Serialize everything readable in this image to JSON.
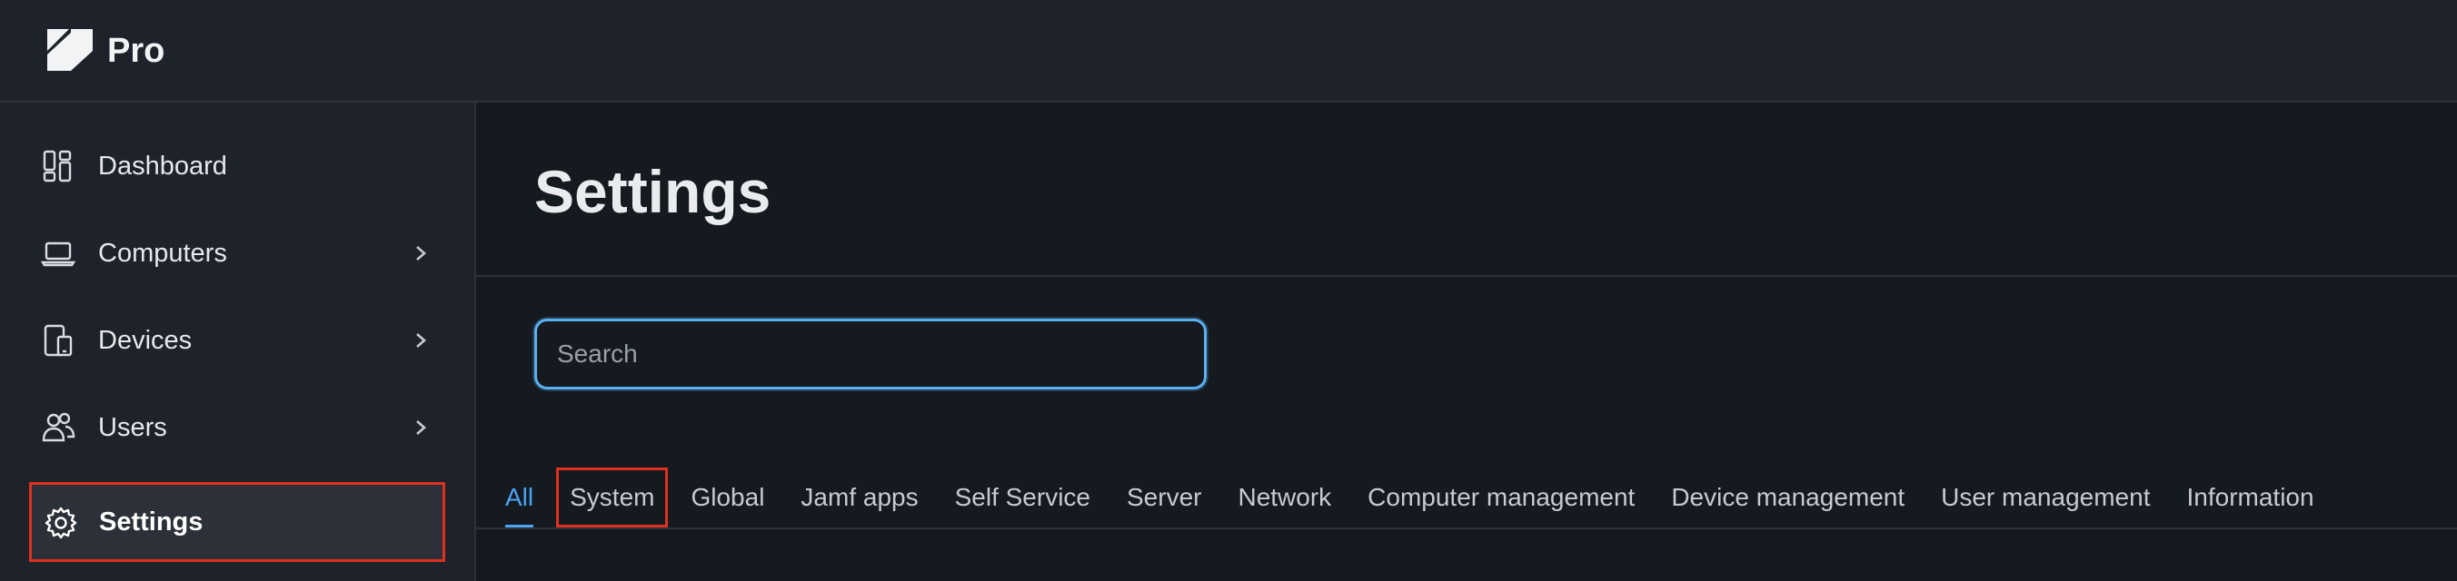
{
  "header": {
    "brand": "Pro",
    "logo_icon": "jamf-logo-icon"
  },
  "sidebar": {
    "items": [
      {
        "label": "Dashboard",
        "icon": "dashboard-icon",
        "has_submenu": false
      },
      {
        "label": "Computers",
        "icon": "laptop-icon",
        "has_submenu": true
      },
      {
        "label": "Devices",
        "icon": "devices-icon",
        "has_submenu": true
      },
      {
        "label": "Users",
        "icon": "users-icon",
        "has_submenu": true
      },
      {
        "label": "Settings",
        "icon": "gear-icon",
        "has_submenu": false,
        "active": true
      }
    ]
  },
  "main": {
    "title": "Settings",
    "search": {
      "placeholder": "Search",
      "value": ""
    },
    "tabs": [
      {
        "label": "All",
        "selected": true
      },
      {
        "label": "System"
      },
      {
        "label": "Global"
      },
      {
        "label": "Jamf apps"
      },
      {
        "label": "Self Service"
      },
      {
        "label": "Server"
      },
      {
        "label": "Network"
      },
      {
        "label": "Computer management"
      },
      {
        "label": "Device management"
      },
      {
        "label": "User management"
      },
      {
        "label": "Information"
      }
    ]
  },
  "colors": {
    "accent": "#4ea4f2",
    "highlight_border": "#e0301e",
    "background": "#151920",
    "panel": "#1e222a"
  }
}
